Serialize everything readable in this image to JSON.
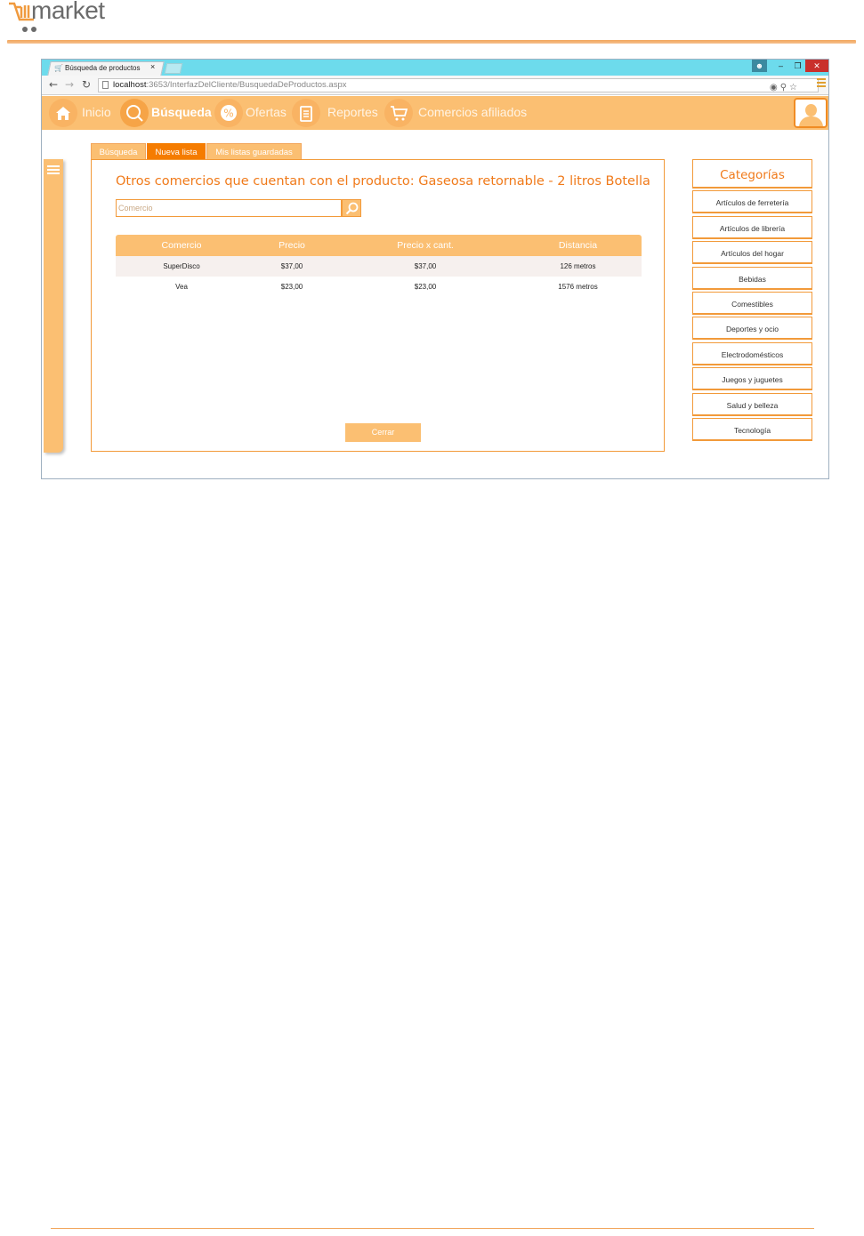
{
  "doc": {
    "logo_text": "market"
  },
  "browser": {
    "tab_title": "Búsqueda de productos",
    "tab_close": "×",
    "url_host": "localhost",
    "url_path": ":3653/InterfazDelCliente/BusquedaDeProductos.aspx"
  },
  "nav": {
    "items": [
      {
        "label": "Inicio",
        "icon": "home-icon"
      },
      {
        "label": "Búsqueda",
        "icon": "search-icon",
        "active": true
      },
      {
        "label": "Ofertas",
        "icon": "percent-icon"
      },
      {
        "label": "Reportes",
        "icon": "clipboard-icon"
      },
      {
        "label": "Comercios afiliados",
        "icon": "cart-icon"
      }
    ]
  },
  "tabs": [
    {
      "label": "Búsqueda"
    },
    {
      "label": "Nueva lista",
      "active": true
    },
    {
      "label": "Mis listas guardadas"
    }
  ],
  "main": {
    "heading": "Otros comercios que cuentan con el producto: Gaseosa retornable - 2 litros Botella",
    "search_placeholder": "Comercio",
    "close_label": "Cerrar"
  },
  "table": {
    "headers": [
      "Comercio",
      "Precio",
      "Precio x cant.",
      "Distancia"
    ],
    "rows": [
      [
        "SuperDisco",
        "$37,00",
        "$37,00",
        "126 metros"
      ],
      [
        "Vea",
        "$23,00",
        "$23,00",
        "1576 metros"
      ]
    ]
  },
  "categories": {
    "title": "Categorías",
    "items": [
      "Artículos de ferretería",
      "Artículos de librería",
      "Artículos del hogar",
      "Bebidas",
      "Comestibles",
      "Deportes y ocio",
      "Electrodomésticos",
      "Juegos y juguetes",
      "Salud y belleza",
      "Tecnología"
    ]
  },
  "colors": {
    "accent": "#fbbf72",
    "accent_dark": "#f57c00",
    "heading": "#f07a1a",
    "titlebar": "#6ddbec"
  }
}
